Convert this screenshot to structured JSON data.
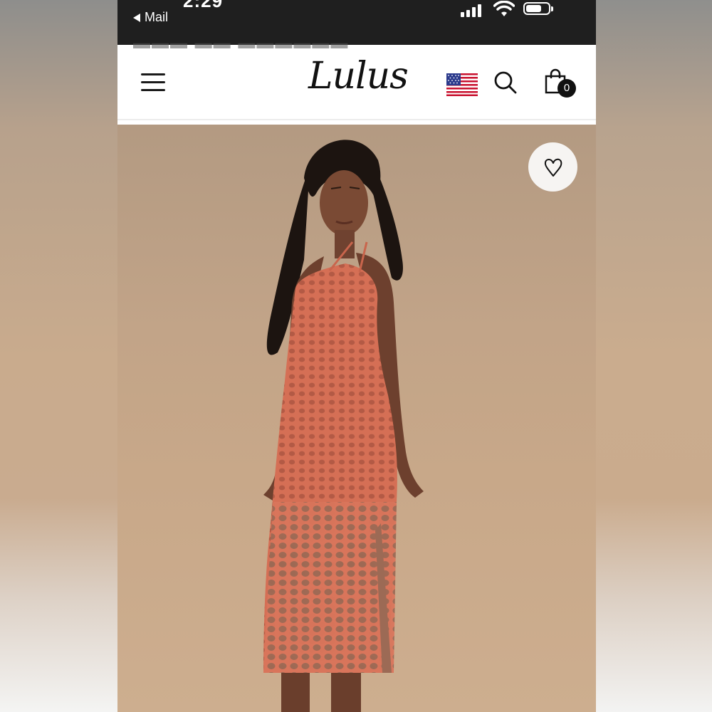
{
  "status_bar": {
    "time": "2:29",
    "back_label": "Mail",
    "battery_level": 0.7
  },
  "header": {
    "partial_title": "?",
    "logo_text": "Lulus",
    "cart_count": "0"
  },
  "icons": {
    "menu": "hamburger-menu-icon",
    "flag": "us-flag-icon",
    "search": "search-icon",
    "cart": "shopping-bag-icon",
    "wishlist": "heart-icon"
  },
  "product": {
    "dress_color": "#d9735a",
    "background_color": "#c3a587"
  }
}
